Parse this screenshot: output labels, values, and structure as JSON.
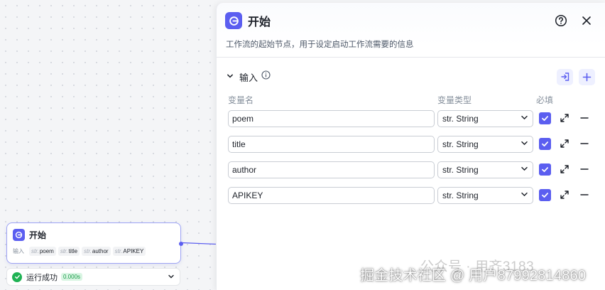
{
  "node": {
    "title": "开始",
    "inputs_label": "输入",
    "vars": [
      {
        "type": "str.",
        "name": "poem"
      },
      {
        "type": "str.",
        "name": "title"
      },
      {
        "type": "str.",
        "name": "author"
      },
      {
        "type": "str.",
        "name": "APIKEY"
      }
    ]
  },
  "run_status": {
    "text": "运行成功",
    "time": "0.000s"
  },
  "panel": {
    "title": "开始",
    "description": "工作流的起始节点，用于设定启动工作流需要的信息",
    "section_title": "输入",
    "columns": {
      "name": "变量名",
      "type": "变量类型",
      "required": "必填"
    },
    "rows": [
      {
        "name": "poem",
        "type": "str. String",
        "required": true
      },
      {
        "name": "title",
        "type": "str. String",
        "required": true
      },
      {
        "name": "author",
        "type": "str. String",
        "required": true
      },
      {
        "name": "APIKEY",
        "type": "str. String",
        "required": true
      }
    ]
  },
  "watermark": {
    "line1": "公众号 · 用齐3183",
    "line2": "掘金技术社区 @ 用户87992814860"
  },
  "colors": {
    "accent": "#5b5ef0",
    "success": "#1fb254",
    "accent_light": "#eef0ff"
  },
  "icons": [
    "start-logo-icon",
    "help-circle-icon",
    "close-icon",
    "chevron-down-icon",
    "info-icon",
    "import-icon",
    "plus-icon",
    "checkbox-checked-icon",
    "expand-icon",
    "minus-icon",
    "check-circle-icon"
  ]
}
